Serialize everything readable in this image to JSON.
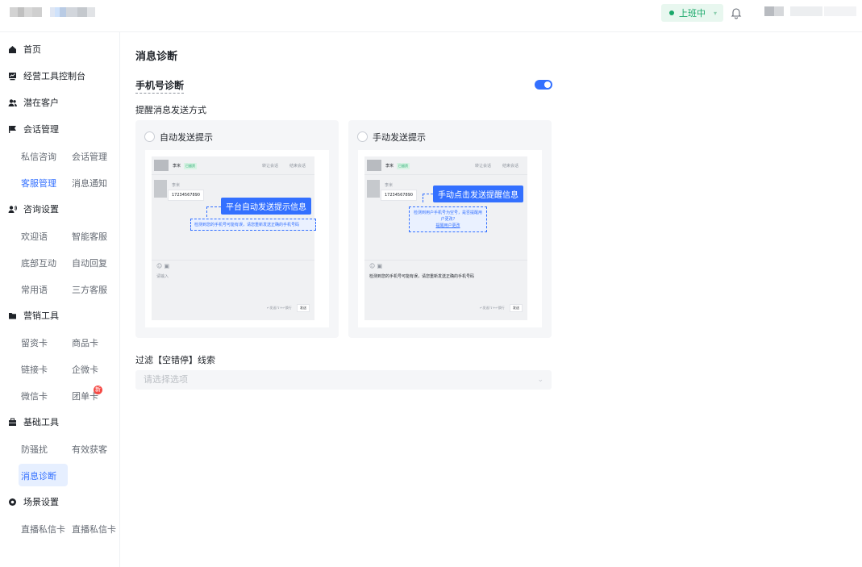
{
  "header": {
    "status_label": "上班中",
    "status_color": "#1aa86a",
    "bell_icon": "bell-icon"
  },
  "sidebar": {
    "home": "首页",
    "console": "经营工具控制台",
    "potential_customers": "潜在客户",
    "session_mgmt": "会话管理",
    "session_items": [
      "私信咨询",
      "会话管理",
      "客服管理",
      "消息通知"
    ],
    "consult_settings": "咨询设置",
    "consult_items": [
      "欢迎语",
      "智能客服",
      "底部互动",
      "自动回复",
      "常用语",
      "三方客服"
    ],
    "marketing_tools": "营销工具",
    "marketing_items": [
      "留资卡",
      "商品卡",
      "链接卡",
      "企微卡",
      "微信卡",
      "团单卡"
    ],
    "new_badge": "新",
    "basic_tools": "基础工具",
    "basic_items": [
      "防骚扰",
      "有效获客",
      "消息诊断"
    ],
    "scene_settings": "场景设置",
    "scene_items": [
      "直播私信卡",
      "直播私信卡"
    ]
  },
  "main": {
    "title": "消息诊断",
    "section_title": "手机号诊断",
    "toggle_on": true,
    "send_mode_label": "提醒消息发送方式",
    "option_auto": "自动发送提示",
    "option_manual": "手动发送提示",
    "auto_preview": {
      "name": "李米",
      "tag": "已留资",
      "head_actions": [
        "转让会话",
        "结束会话"
      ],
      "sender_label": "李米",
      "phone": "17234567890",
      "callout": "平台自动发送提示信息",
      "notice": "检测到您的手机号可能有误，请您重新发送正确的手机号码",
      "input_placeholder": "请输入",
      "footer_hint": "↵发送/⇧+↵换行",
      "send": "发送"
    },
    "manual_preview": {
      "name": "李米",
      "tag": "已留资",
      "head_actions": [
        "转让会话",
        "结束会话"
      ],
      "sender_label": "李米",
      "phone": "17234567890",
      "callout": "手动点击发送提醒信息",
      "notice": "检测到用户手机号为空号，是否提醒用户更改?",
      "notice_link": "提醒用户更改",
      "draft": "检测到您的手机号可能有误，请您重新发送正确的手机号码",
      "footer_hint": "↵发送/⇧+↵换行",
      "send": "发送"
    },
    "filter_label": "过滤【空错停】线索",
    "filter_placeholder": "请选择选项"
  },
  "colors": {
    "accent": "#3370ff",
    "green": "#1aa86a",
    "red_badge": "#f54a45"
  }
}
